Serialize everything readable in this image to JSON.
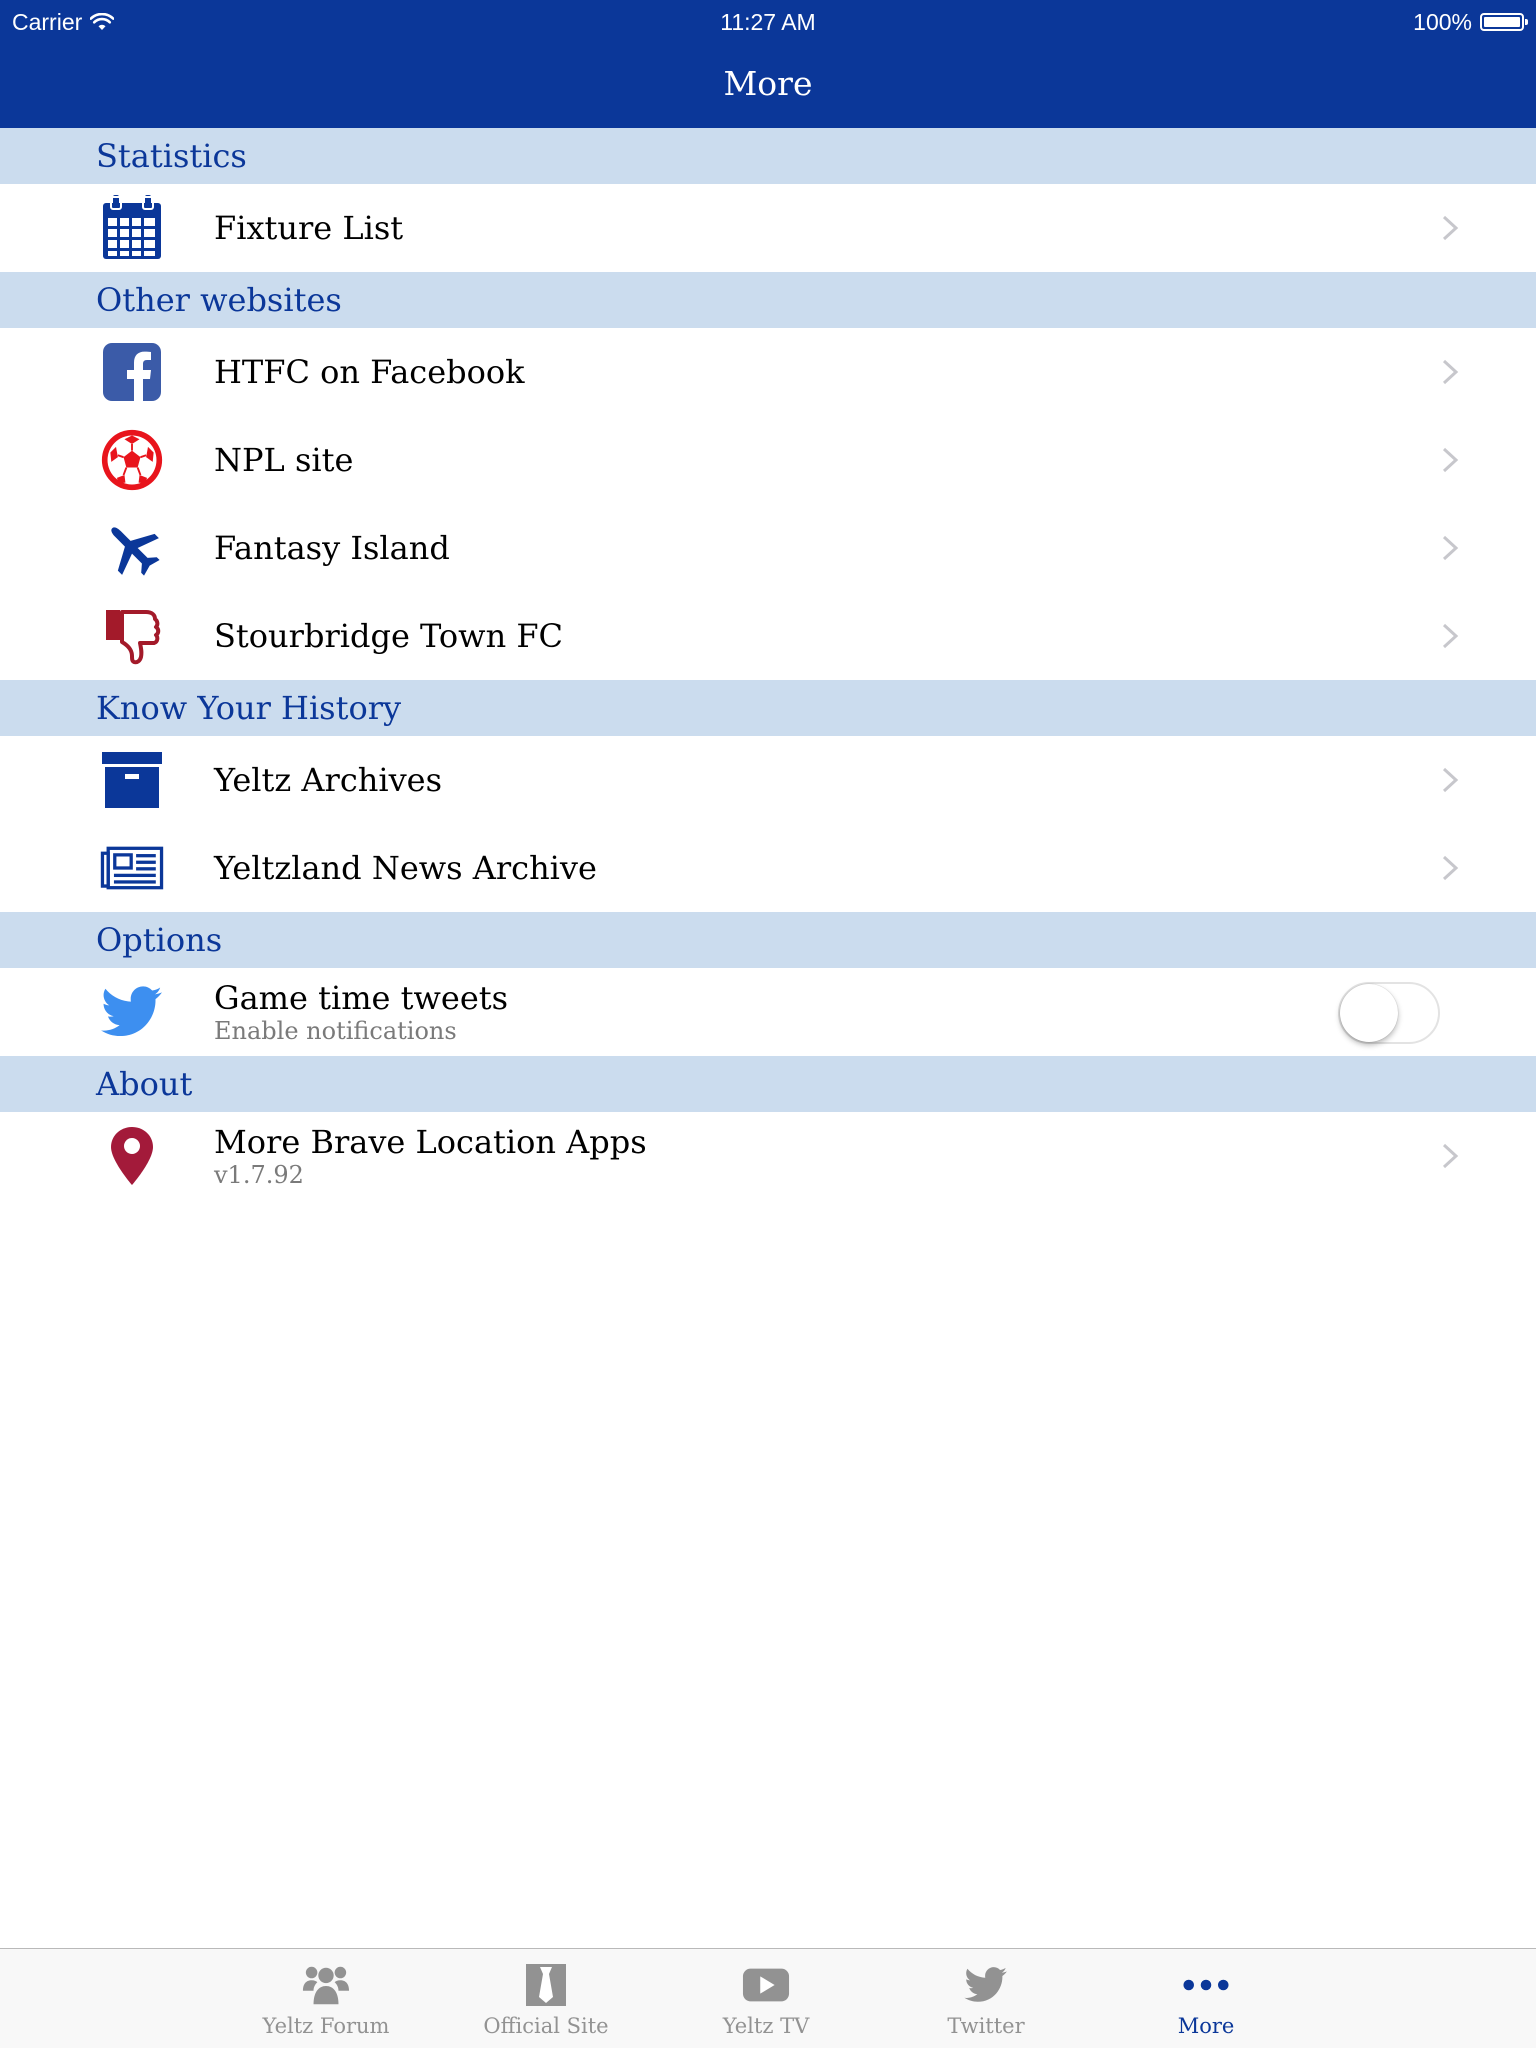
{
  "status_bar": {
    "carrier": "Carrier",
    "time": "11:27 AM",
    "battery": "100%"
  },
  "nav": {
    "title": "More"
  },
  "colors": {
    "brand": "#0b3799",
    "section_bg": "#cbdcee",
    "red": "#e8141c",
    "dark_red": "#a31a2a",
    "twitter": "#3d8ff0"
  },
  "sections": [
    {
      "header": "Statistics",
      "rows": [
        {
          "label": "Fixture List",
          "icon": "calendar-icon"
        }
      ]
    },
    {
      "header": "Other websites",
      "rows": [
        {
          "label": "HTFC on Facebook",
          "icon": "facebook-icon"
        },
        {
          "label": "NPL site",
          "icon": "football-icon"
        },
        {
          "label": "Fantasy Island",
          "icon": "plane-icon"
        },
        {
          "label": "Stourbridge Town FC",
          "icon": "thumbs-down-icon"
        }
      ]
    },
    {
      "header": "Know Your History",
      "rows": [
        {
          "label": "Yeltz Archives",
          "icon": "archive-box-icon"
        },
        {
          "label": "Yeltzland News Archive",
          "icon": "newspaper-icon"
        }
      ]
    },
    {
      "header": "Options",
      "rows": [
        {
          "label": "Game time tweets",
          "sublabel": "Enable notifications",
          "icon": "twitter-icon",
          "toggle_on": false
        }
      ]
    },
    {
      "header": "About",
      "rows": [
        {
          "label": "More Brave Location Apps",
          "sublabel": "v1.7.92",
          "icon": "map-pin-icon"
        }
      ]
    }
  ],
  "tabs": [
    {
      "label": "Yeltz Forum",
      "icon": "users-icon",
      "active": false
    },
    {
      "label": "Official Site",
      "icon": "tie-icon",
      "active": false
    },
    {
      "label": "Yeltz TV",
      "icon": "play-icon",
      "active": false
    },
    {
      "label": "Twitter",
      "icon": "twitter-icon",
      "active": false
    },
    {
      "label": "More",
      "icon": "more-dots-icon",
      "active": true
    }
  ]
}
